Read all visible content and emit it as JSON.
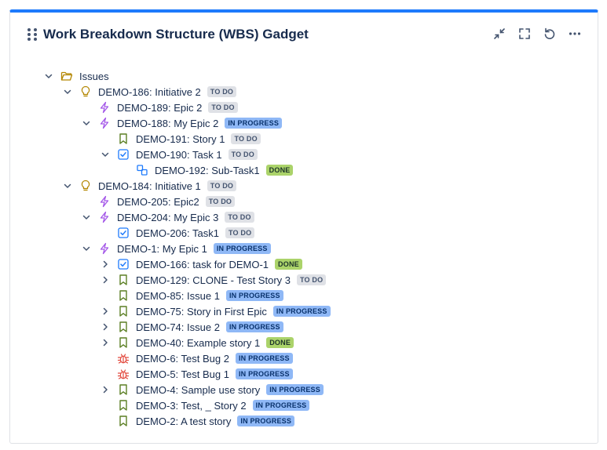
{
  "gadget": {
    "title": "Work Breakdown Structure (WBS) Gadget",
    "accent_color": "#1d7afc",
    "actions": [
      {
        "name": "minimize-icon"
      },
      {
        "name": "fullscreen-icon"
      },
      {
        "name": "refresh-icon"
      },
      {
        "name": "more-icon"
      }
    ]
  },
  "tree": [
    {
      "depth": 0,
      "chevron": "open",
      "icon": "folder-icon",
      "label": "Issues",
      "status": ""
    },
    {
      "depth": 1,
      "chevron": "open",
      "icon": "initiative-icon",
      "label": "DEMO-186: Initiative 2",
      "status": "TO DO",
      "status_type": "todo"
    },
    {
      "depth": 2,
      "chevron": "none",
      "icon": "epic-icon",
      "label": "DEMO-189: Epic 2",
      "status": "TO DO",
      "status_type": "todo"
    },
    {
      "depth": 2,
      "chevron": "open",
      "icon": "epic-icon",
      "label": "DEMO-188: My Epic 2",
      "status": "IN PROGRESS",
      "status_type": "inprogress"
    },
    {
      "depth": 3,
      "chevron": "none",
      "icon": "story-icon",
      "label": "DEMO-191: Story 1",
      "status": "TO DO",
      "status_type": "todo"
    },
    {
      "depth": 3,
      "chevron": "open",
      "icon": "task-icon",
      "label": "DEMO-190: Task 1",
      "status": "TO DO",
      "status_type": "todo"
    },
    {
      "depth": 4,
      "chevron": "none",
      "icon": "subtask-icon",
      "label": "DEMO-192: Sub-Task1",
      "status": "DONE",
      "status_type": "done"
    },
    {
      "depth": 1,
      "chevron": "open",
      "icon": "initiative-icon",
      "label": "DEMO-184: Initiative 1",
      "status": "TO DO",
      "status_type": "todo"
    },
    {
      "depth": 2,
      "chevron": "none",
      "icon": "epic-icon",
      "label": "DEMO-205: Epic2",
      "status": "TO DO",
      "status_type": "todo"
    },
    {
      "depth": 2,
      "chevron": "open",
      "icon": "epic-icon",
      "label": "DEMO-204: My Epic 3",
      "status": "TO DO",
      "status_type": "todo"
    },
    {
      "depth": 3,
      "chevron": "none",
      "icon": "task-icon",
      "label": "DEMO-206: Task1",
      "status": "TO DO",
      "status_type": "todo"
    },
    {
      "depth": 2,
      "chevron": "open",
      "icon": "epic-icon",
      "label": "DEMO-1: My Epic 1",
      "status": "IN PROGRESS",
      "status_type": "inprogress"
    },
    {
      "depth": 3,
      "chevron": "closed",
      "icon": "task-icon",
      "label": "DEMO-166: task for DEMO-1",
      "status": "DONE",
      "status_type": "done"
    },
    {
      "depth": 3,
      "chevron": "closed",
      "icon": "story-icon",
      "label": "DEMO-129: CLONE - Test Story 3",
      "status": "TO DO",
      "status_type": "todo"
    },
    {
      "depth": 3,
      "chevron": "none",
      "icon": "story-icon",
      "label": "DEMO-85: Issue 1",
      "status": "IN PROGRESS",
      "status_type": "inprogress"
    },
    {
      "depth": 3,
      "chevron": "closed",
      "icon": "story-icon",
      "label": "DEMO-75: Story in First Epic",
      "status": "IN PROGRESS",
      "status_type": "inprogress"
    },
    {
      "depth": 3,
      "chevron": "closed",
      "icon": "story-icon",
      "label": "DEMO-74: Issue 2",
      "status": "IN PROGRESS",
      "status_type": "inprogress"
    },
    {
      "depth": 3,
      "chevron": "closed",
      "icon": "story-icon",
      "label": "DEMO-40: Example story 1",
      "status": "DONE",
      "status_type": "done"
    },
    {
      "depth": 3,
      "chevron": "none",
      "icon": "bug-icon",
      "label": "DEMO-6: Test Bug 2",
      "status": "IN PROGRESS",
      "status_type": "inprogress"
    },
    {
      "depth": 3,
      "chevron": "none",
      "icon": "bug-icon",
      "label": "DEMO-5: Test Bug 1",
      "status": "IN PROGRESS",
      "status_type": "inprogress"
    },
    {
      "depth": 3,
      "chevron": "closed",
      "icon": "story-icon",
      "label": "DEMO-4: Sample use story",
      "status": "IN PROGRESS",
      "status_type": "inprogress"
    },
    {
      "depth": 3,
      "chevron": "none",
      "icon": "story-icon",
      "label": "DEMO-3: Test, _ Story 2",
      "status": "IN PROGRESS",
      "status_type": "inprogress"
    },
    {
      "depth": 3,
      "chevron": "none",
      "icon": "story-icon",
      "label": "DEMO-2: A test story",
      "status": "IN PROGRESS",
      "status_type": "inprogress"
    }
  ]
}
